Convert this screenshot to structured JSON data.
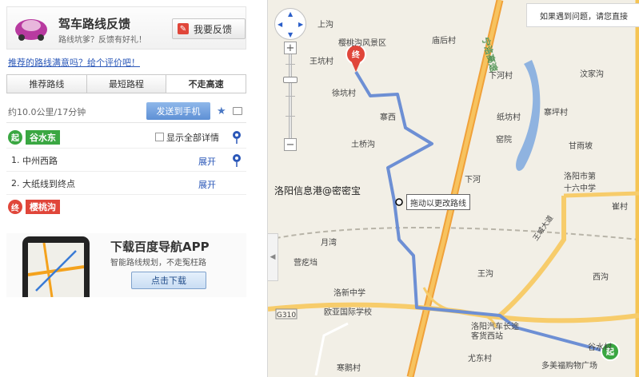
{
  "panel": {
    "feedback": {
      "title": "驾车路线反馈",
      "subtitle": "路线坑爹？反馈有好礼！",
      "button": "我要反馈"
    },
    "rate_link": "推荐的路线满意吗？给个评价吧！",
    "tabs": [
      {
        "label": "推荐路线",
        "active": false
      },
      {
        "label": "最短路程",
        "active": false
      },
      {
        "label": "不走高速",
        "active": true
      }
    ],
    "summary": {
      "distance": "约10.0公里/17分钟",
      "send_button": "发送到手机"
    },
    "start": {
      "badge": "起",
      "name": "谷水东"
    },
    "show_all": "显示全部详情",
    "steps": [
      {
        "num": "1.",
        "text": "中州西路",
        "action": "展开"
      },
      {
        "num": "2.",
        "text": "大纸线到终点",
        "action": "展开"
      }
    ],
    "end": {
      "badge": "终",
      "name": "樱桃沟"
    },
    "ad": {
      "title": "下载百度导航APP",
      "subtitle": "智能路线规划，不走冤枉路",
      "button": "点击下载"
    }
  },
  "map": {
    "notice": "如果遇到问题，请您直接",
    "watermark": "洛阳信息港@密密宝",
    "drag_hint": "拖动以更改路线",
    "road_badge": "G310",
    "highway_name": "宁洛高速",
    "ring_name": "王城大道",
    "labels": {
      "shanggou": "上沟",
      "yingtaogou": "樱桃沟风景区",
      "wangkeng": "王坑村",
      "miaohou": "庙后村",
      "xiahe": "下河村",
      "wenjia": "汶家沟",
      "xukeng": "徐坑村",
      "zhaixi": "寨西",
      "zhaiping": "寨坪村",
      "zhifang": "纸坊村",
      "kuyuan": "窑院",
      "ganyu": "甘雨坡",
      "tuqiao": "土桥沟",
      "xiahe2": "下河",
      "school16": "洛阳市第十六中学",
      "cui": "崔村",
      "yuewan": "月湾",
      "yingzhu": "营疙垱",
      "wanggou": "王沟",
      "xixiang": "西沟",
      "xinzhong": "洛新中学",
      "ouya": "欧亚国际学校",
      "qichezhan": "洛阳汽车长途客货西站",
      "youdong": "尤东村",
      "hanjia": "寒鹅村",
      "gushui": "谷水村",
      "meimei": "多美福购物广场"
    }
  }
}
